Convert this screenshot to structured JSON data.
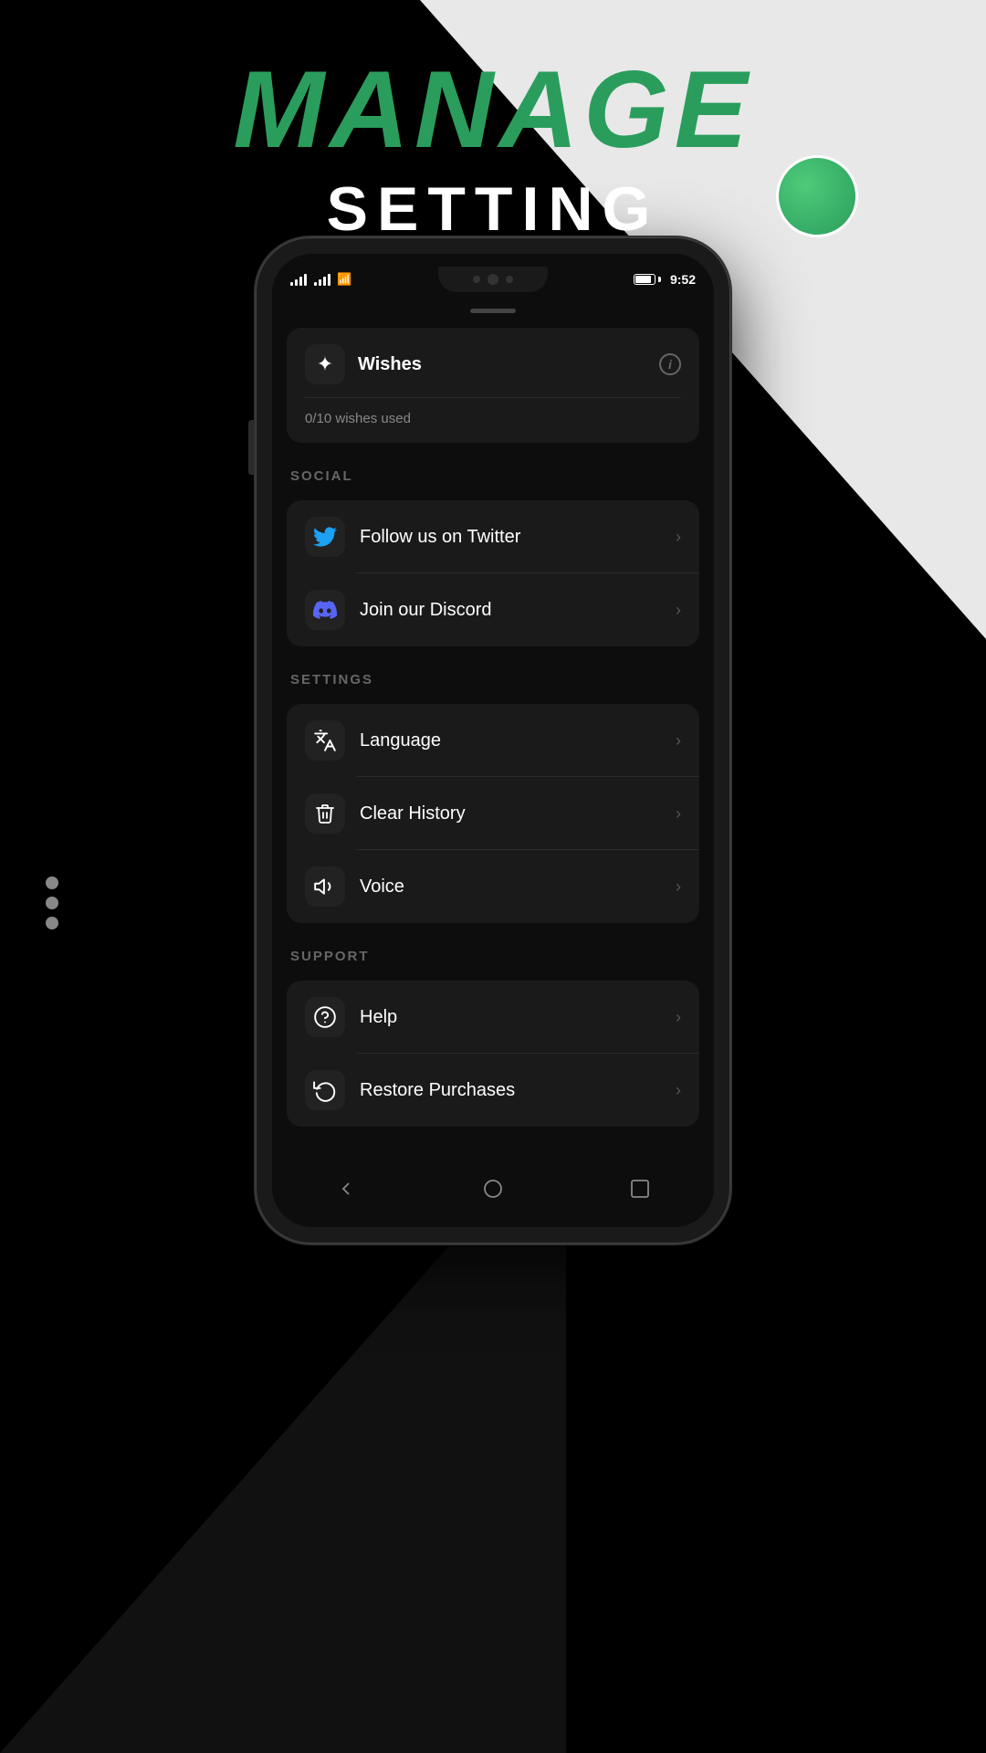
{
  "header": {
    "manage_label": "MANAGE",
    "setting_label": "SETTING"
  },
  "three_dots": "...",
  "phone": {
    "status_bar": {
      "time": "9:52"
    },
    "drag_handle": true,
    "wishes": {
      "icon": "✦",
      "title": "Wishes",
      "info_label": "i",
      "divider": true,
      "count": "0/10 wishes used"
    },
    "social_section": {
      "label": "SOCIAL",
      "items": [
        {
          "id": "twitter",
          "label": "Follow us on Twitter",
          "icon_type": "twitter"
        },
        {
          "id": "discord",
          "label": "Join our Discord",
          "icon_type": "discord"
        }
      ]
    },
    "settings_section": {
      "label": "SETTINGS",
      "items": [
        {
          "id": "language",
          "label": "Language",
          "icon_type": "language"
        },
        {
          "id": "clear-history",
          "label": "Clear History",
          "icon_type": "trash"
        },
        {
          "id": "voice",
          "label": "Voice",
          "icon_type": "volume"
        }
      ]
    },
    "support_section": {
      "label": "SUPPORT",
      "items": [
        {
          "id": "help",
          "label": "Help",
          "icon_type": "help"
        },
        {
          "id": "restore",
          "label": "Restore Purchases",
          "icon_type": "restore"
        }
      ]
    }
  }
}
